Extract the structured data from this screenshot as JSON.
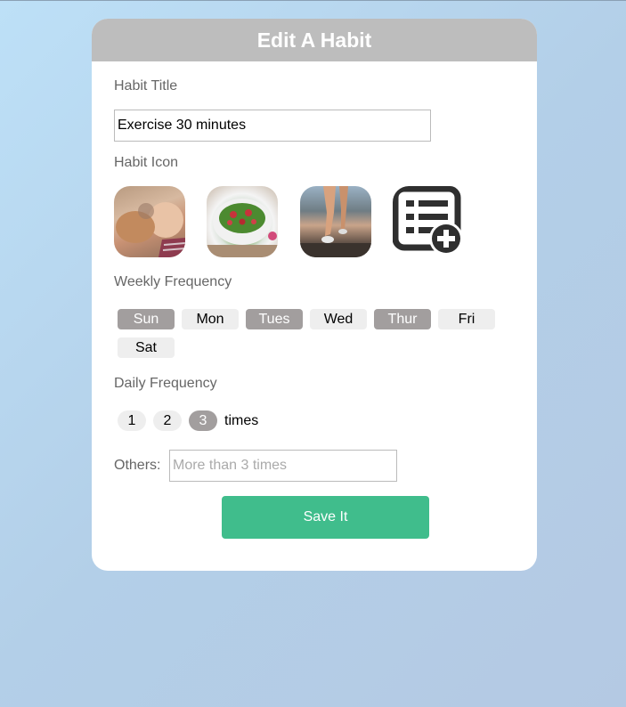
{
  "card": {
    "title": "Edit A Habit"
  },
  "habit_title": {
    "label": "Habit Title",
    "value": "Exercise 30 minutes"
  },
  "habit_icon": {
    "label": "Habit Icon",
    "options": [
      "baby-and-cat-photo",
      "salad-bowl-photo",
      "running-legs-photo",
      "add-list-icon"
    ]
  },
  "weekly_frequency": {
    "label": "Weekly Frequency",
    "days": [
      {
        "label": "Sun",
        "selected": true
      },
      {
        "label": "Mon",
        "selected": false
      },
      {
        "label": "Tues",
        "selected": true
      },
      {
        "label": "Wed",
        "selected": false
      },
      {
        "label": "Thur",
        "selected": true
      },
      {
        "label": "Fri",
        "selected": false
      },
      {
        "label": "Sat",
        "selected": false
      }
    ]
  },
  "daily_frequency": {
    "label": "Daily Frequency",
    "options": [
      {
        "label": "1",
        "selected": false
      },
      {
        "label": "2",
        "selected": false
      },
      {
        "label": "3",
        "selected": true
      }
    ],
    "suffix": "times"
  },
  "others": {
    "label": "Others:",
    "placeholder": "More than 3 times",
    "value": ""
  },
  "save_button": {
    "label": "Save It"
  },
  "colors": {
    "header_bg": "#bdbdbd",
    "selected_bg": "#a29e9e",
    "unselected_bg": "#eeeeee",
    "save_bg": "#40bd8c"
  }
}
